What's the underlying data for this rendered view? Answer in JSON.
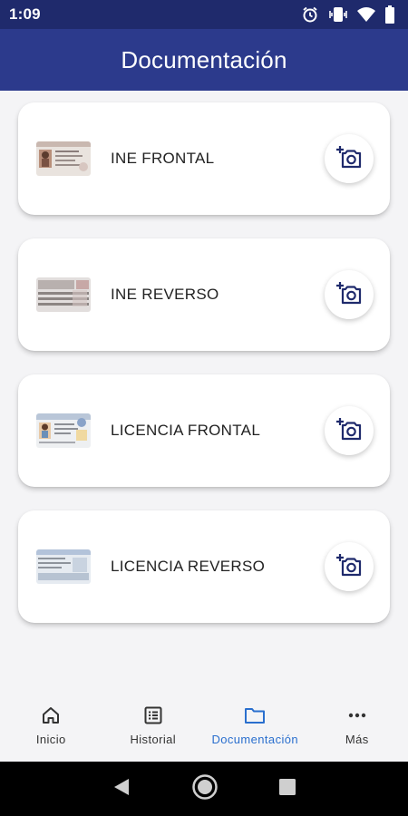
{
  "status_bar": {
    "time": "1:09",
    "icons": [
      "alarm-icon",
      "vibrate-icon",
      "wifi-icon",
      "battery-icon"
    ]
  },
  "app_bar": {
    "title": "Documentación"
  },
  "documents": [
    {
      "label": "INE FRONTAL",
      "thumbnail": "ine-front-thumb",
      "action_icon": "add-photo-icon"
    },
    {
      "label": "INE REVERSO",
      "thumbnail": "ine-back-thumb",
      "action_icon": "add-photo-icon"
    },
    {
      "label": "LICENCIA FRONTAL",
      "thumbnail": "license-front-thumb",
      "action_icon": "add-photo-icon"
    },
    {
      "label": "LICENCIA REVERSO",
      "thumbnail": "license-back-thumb",
      "action_icon": "add-photo-icon"
    }
  ],
  "bottom_nav": {
    "items": [
      {
        "label": "Inicio",
        "icon": "home-icon",
        "active": false
      },
      {
        "label": "Historial",
        "icon": "list-icon",
        "active": false
      },
      {
        "label": "Documentación",
        "icon": "folder-icon",
        "active": true
      },
      {
        "label": "Más",
        "icon": "more-icon",
        "active": false
      }
    ]
  },
  "system_nav": {
    "icons": [
      "back-icon",
      "home-circle-icon",
      "recents-icon"
    ]
  },
  "colors": {
    "status_bar": "#1f2a6c",
    "app_bar": "#2c3a8c",
    "accent": "#2a6fce",
    "action_icon": "#1f2a6c",
    "background": "#f4f4f6"
  }
}
